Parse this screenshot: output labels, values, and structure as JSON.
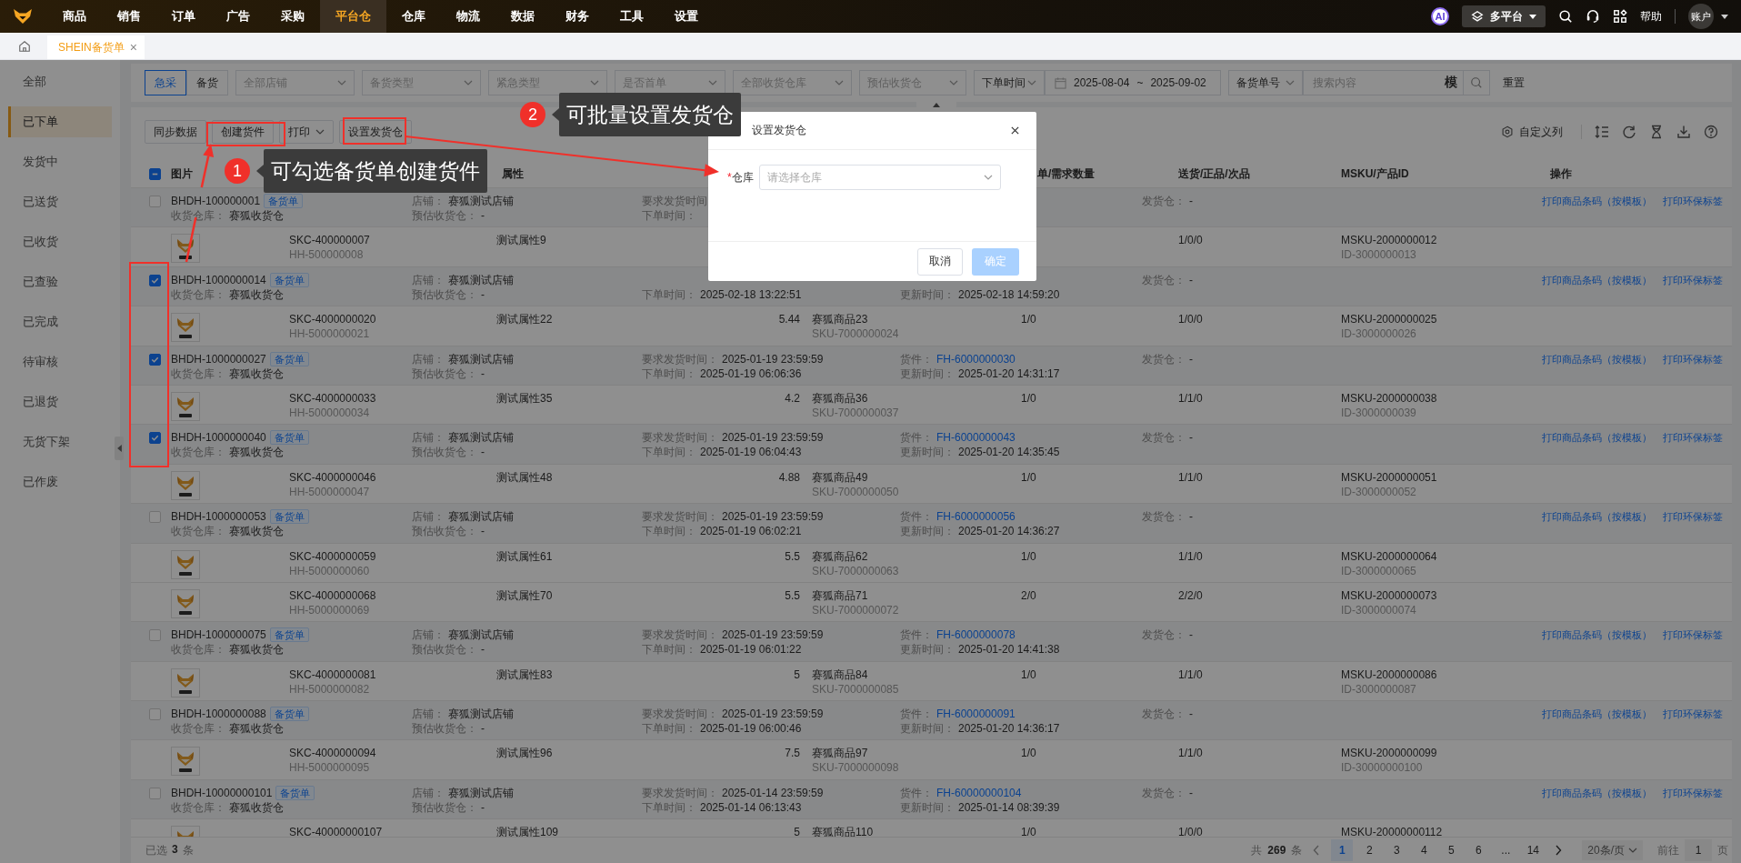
{
  "nav": {
    "items": [
      {
        "label": "商品",
        "selected": false
      },
      {
        "label": "销售",
        "selected": false
      },
      {
        "label": "订单",
        "selected": false
      },
      {
        "label": "广告",
        "selected": false
      },
      {
        "label": "采购",
        "selected": false
      },
      {
        "label": "平台仓",
        "selected": true
      },
      {
        "label": "仓库",
        "selected": false
      },
      {
        "label": "物流",
        "selected": false
      },
      {
        "label": "数据",
        "selected": false
      },
      {
        "label": "财务",
        "selected": false
      },
      {
        "label": "工具",
        "selected": false
      },
      {
        "label": "设置",
        "selected": false
      }
    ],
    "ai": "AI",
    "platform": "多平台",
    "help": "帮助",
    "account": "账户"
  },
  "tabs": [
    {
      "label": "SHEIN备货单",
      "selected": true,
      "close": "×"
    }
  ],
  "sidebar": {
    "items": [
      {
        "label": "全部",
        "selected": false
      },
      {
        "label": "已下单",
        "selected": true
      },
      {
        "label": "发货中",
        "selected": false
      },
      {
        "label": "已送货",
        "selected": false
      },
      {
        "label": "已收货",
        "selected": false
      },
      {
        "label": "已查验",
        "selected": false
      },
      {
        "label": "已完成",
        "selected": false
      },
      {
        "label": "待审核",
        "selected": false
      },
      {
        "label": "已退货",
        "selected": false
      },
      {
        "label": "无货下架",
        "selected": false
      },
      {
        "label": "已作废",
        "selected": false
      }
    ]
  },
  "filters": {
    "mode": [
      {
        "label": "急采",
        "selected": true
      },
      {
        "label": "备货",
        "selected": false
      }
    ],
    "selects": [
      {
        "placeholder": "全部店铺"
      },
      {
        "placeholder": "备货类型"
      },
      {
        "placeholder": "紧急类型"
      },
      {
        "placeholder": "是否首单"
      },
      {
        "placeholder": "全部收货仓库"
      },
      {
        "placeholder": "预估收货仓"
      }
    ],
    "time_type": "下单时间",
    "date_from": "2025-08-04",
    "date_sep": "~",
    "date_to": "2025-09-02",
    "search_type": "备货单号",
    "search_placeholder": "搜索内容",
    "fuzzy": "模",
    "reset": "重置"
  },
  "toolbar": {
    "buttons": [
      {
        "label": "同步数据",
        "kind": "plain"
      },
      {
        "label": "创建货件",
        "kind": "plain"
      },
      {
        "label": "打印",
        "kind": "dropdown"
      },
      {
        "label": "设置发货仓",
        "kind": "plain"
      }
    ],
    "custom_columns": "自定义列"
  },
  "table": {
    "select_all_indeterminate": true,
    "columns": {
      "image": "图片",
      "attribute": "属性",
      "quantity": "单/需求数量",
      "delivery": "送货/正品/次品",
      "msku": "MSKU/产品ID",
      "actions": "操作"
    },
    "rows": [
      {
        "kind": "order",
        "checked": false,
        "id": "BHDH-100000001",
        "tag": "备货单",
        "warehouse": {
          "label": "收货仓库：",
          "value": "赛狐收货仓"
        },
        "shop": {
          "label": "店铺：",
          "value": "赛狐测试店铺"
        },
        "est": {
          "label": "预估收货仓：",
          "value": "-"
        },
        "ship_time": {
          "label": "要求发货时间"
        },
        "order_time": {
          "label": "下单时间："
        },
        "ship_from": {
          "label": "发货仓：",
          "value": "-"
        },
        "actions": [
          "打印商品条码（按模板）",
          "打印环保标签"
        ]
      },
      {
        "kind": "item",
        "skc": "SKC-400000007",
        "hh": "HH-500000008",
        "attribute": "测试属性9",
        "delivery": "1/0/0",
        "msku": "MSKU-2000000012",
        "product_id": "ID-3000000013"
      },
      {
        "kind": "order",
        "checked": true,
        "id": "BHDH-1000000014",
        "tag": "备货单",
        "warehouse": {
          "label": "收货仓库：",
          "value": "赛狐收货仓"
        },
        "shop": {
          "label": "店铺：",
          "value": "赛狐测试店铺"
        },
        "est": {
          "label": "预估收货仓：",
          "value": "-"
        },
        "order_time": {
          "label": "下单时间：",
          "value": "2025-02-18 13:22:51"
        },
        "update_time": {
          "label": "更新时间：",
          "value": "2025-02-18 14:59:20"
        },
        "ship_from": {
          "label": "发货仓：",
          "value": "-"
        },
        "actions": [
          "打印商品条码（按模板）",
          "打印环保标签"
        ]
      },
      {
        "kind": "item",
        "skc": "SKC-4000000020",
        "hh": "HH-5000000021",
        "attribute": "测试属性22",
        "price": "5.44",
        "name": "赛狐商品23",
        "sku": "SKU-7000000024",
        "quantity": "1/0",
        "delivery": "1/0/0",
        "msku": "MSKU-2000000025",
        "product_id": "ID-3000000026"
      },
      {
        "kind": "order",
        "checked": true,
        "id": "BHDH-1000000027",
        "tag": "备货单",
        "warehouse": {
          "label": "收货仓库：",
          "value": "赛狐收货仓"
        },
        "shop": {
          "label": "店铺：",
          "value": "赛狐测试店铺"
        },
        "est": {
          "label": "预估收货仓：",
          "value": "-"
        },
        "ship_time": {
          "label": "要求发货时间：",
          "value": "2025-01-19 23:59:59"
        },
        "order_time": {
          "label": "下单时间：",
          "value": "2025-01-19 06:06:36"
        },
        "shipment": {
          "label": "货件：",
          "value": "FH-6000000030"
        },
        "update_time": {
          "label": "更新时间：",
          "value": "2025-01-20 14:31:17"
        },
        "ship_from": {
          "label": "发货仓：",
          "value": "-"
        },
        "actions": [
          "打印商品条码（按模板）",
          "打印环保标签"
        ]
      },
      {
        "kind": "item",
        "skc": "SKC-4000000033",
        "hh": "HH-5000000034",
        "attribute": "测试属性35",
        "price": "4.2",
        "name": "赛狐商品36",
        "sku": "SKU-7000000037",
        "quantity": "1/0",
        "delivery": "1/1/0",
        "msku": "MSKU-2000000038",
        "product_id": "ID-3000000039"
      },
      {
        "kind": "order",
        "checked": true,
        "id": "BHDH-1000000040",
        "tag": "备货单",
        "warehouse": {
          "label": "收货仓库：",
          "value": "赛狐收货仓"
        },
        "shop": {
          "label": "店铺：",
          "value": "赛狐测试店铺"
        },
        "est": {
          "label": "预估收货仓：",
          "value": "-"
        },
        "ship_time": {
          "label": "要求发货时间：",
          "value": "2025-01-19 23:59:59"
        },
        "order_time": {
          "label": "下单时间：",
          "value": "2025-01-19 06:04:43"
        },
        "shipment": {
          "label": "货件：",
          "value": "FH-6000000043"
        },
        "update_time": {
          "label": "更新时间：",
          "value": "2025-01-20 14:35:45"
        },
        "ship_from": {
          "label": "发货仓：",
          "value": "-"
        },
        "actions": [
          "打印商品条码（按模板）",
          "打印环保标签"
        ]
      },
      {
        "kind": "item",
        "skc": "SKC-4000000046",
        "hh": "HH-5000000047",
        "attribute": "测试属性48",
        "price": "4.88",
        "name": "赛狐商品49",
        "sku": "SKU-7000000050",
        "quantity": "1/0",
        "delivery": "1/1/0",
        "msku": "MSKU-2000000051",
        "product_id": "ID-3000000052"
      },
      {
        "kind": "order",
        "checked": false,
        "id": "BHDH-1000000053",
        "tag": "备货单",
        "warehouse": {
          "label": "收货仓库：",
          "value": "赛狐收货仓"
        },
        "shop": {
          "label": "店铺：",
          "value": "赛狐测试店铺"
        },
        "est": {
          "label": "预估收货仓：",
          "value": "-"
        },
        "ship_time": {
          "label": "要求发货时间：",
          "value": "2025-01-19 23:59:59"
        },
        "order_time": {
          "label": "下单时间：",
          "value": "2025-01-19 06:02:21"
        },
        "shipment": {
          "label": "货件：",
          "value": "FH-6000000056"
        },
        "update_time": {
          "label": "更新时间：",
          "value": "2025-01-20 14:36:27"
        },
        "ship_from": {
          "label": "发货仓：",
          "value": "-"
        },
        "actions": [
          "打印商品条码（按模板）",
          "打印环保标签"
        ]
      },
      {
        "kind": "item",
        "skc": "SKC-4000000059",
        "hh": "HH-5000000060",
        "attribute": "测试属性61",
        "price": "5.5",
        "name": "赛狐商品62",
        "sku": "SKU-7000000063",
        "quantity": "1/0",
        "delivery": "1/1/0",
        "msku": "MSKU-2000000064",
        "product_id": "ID-3000000065"
      },
      {
        "kind": "item",
        "skc": "SKC-4000000068",
        "hh": "HH-5000000069",
        "attribute": "测试属性70",
        "price": "5.5",
        "name": "赛狐商品71",
        "sku": "SKU-7000000072",
        "quantity": "2/0",
        "delivery": "2/2/0",
        "msku": "MSKU-2000000073",
        "product_id": "ID-3000000074"
      },
      {
        "kind": "order",
        "checked": false,
        "id": "BHDH-1000000075",
        "tag": "备货单",
        "warehouse": {
          "label": "收货仓库：",
          "value": "赛狐收货仓"
        },
        "shop": {
          "label": "店铺：",
          "value": "赛狐测试店铺"
        },
        "est": {
          "label": "预估收货仓：",
          "value": "-"
        },
        "ship_time": {
          "label": "要求发货时间：",
          "value": "2025-01-19 23:59:59"
        },
        "order_time": {
          "label": "下单时间：",
          "value": "2025-01-19 06:01:22"
        },
        "shipment": {
          "label": "货件：",
          "value": "FH-6000000078"
        },
        "update_time": {
          "label": "更新时间：",
          "value": "2025-01-20 14:41:38"
        },
        "ship_from": {
          "label": "发货仓：",
          "value": "-"
        },
        "actions": [
          "打印商品条码（按模板）",
          "打印环保标签"
        ]
      },
      {
        "kind": "item",
        "skc": "SKC-4000000081",
        "hh": "HH-5000000082",
        "attribute": "测试属性83",
        "price": "5",
        "name": "赛狐商品84",
        "sku": "SKU-7000000085",
        "quantity": "1/0",
        "delivery": "1/1/0",
        "msku": "MSKU-2000000086",
        "product_id": "ID-3000000087"
      },
      {
        "kind": "order",
        "checked": false,
        "id": "BHDH-1000000088",
        "tag": "备货单",
        "warehouse": {
          "label": "收货仓库：",
          "value": "赛狐收货仓"
        },
        "shop": {
          "label": "店铺：",
          "value": "赛狐测试店铺"
        },
        "est": {
          "label": "预估收货仓：",
          "value": "-"
        },
        "ship_time": {
          "label": "要求发货时间：",
          "value": "2025-01-19 23:59:59"
        },
        "order_time": {
          "label": "下单时间：",
          "value": "2025-01-19 06:00:46"
        },
        "shipment": {
          "label": "货件：",
          "value": "FH-6000000091"
        },
        "update_time": {
          "label": "更新时间：",
          "value": "2025-01-20 14:36:17"
        },
        "ship_from": {
          "label": "发货仓：",
          "value": "-"
        },
        "actions": [
          "打印商品条码（按模板）",
          "打印环保标签"
        ]
      },
      {
        "kind": "item",
        "skc": "SKC-4000000094",
        "hh": "HH-5000000095",
        "attribute": "测试属性96",
        "price": "7.5",
        "name": "赛狐商品97",
        "sku": "SKU-7000000098",
        "quantity": "1/0",
        "delivery": "1/1/0",
        "msku": "MSKU-2000000099",
        "product_id": "ID-30000000100"
      },
      {
        "kind": "order",
        "checked": false,
        "id": "BHDH-10000000101",
        "tag": "备货单",
        "warehouse": {
          "label": "收货仓库：",
          "value": "赛狐收货仓"
        },
        "shop": {
          "label": "店铺：",
          "value": "赛狐测试店铺"
        },
        "est": {
          "label": "预估收货仓：",
          "value": "-"
        },
        "ship_time": {
          "label": "要求发货时间：",
          "value": "2025-01-14 23:59:59"
        },
        "order_time": {
          "label": "下单时间：",
          "value": "2025-01-14 06:13:43"
        },
        "shipment": {
          "label": "货件：",
          "value": "FH-60000000104"
        },
        "update_time": {
          "label": "更新时间：",
          "value": "2025-01-14 08:39:39"
        },
        "ship_from": {
          "label": "发货仓：",
          "value": "-"
        },
        "actions": [
          "打印商品条码（按模板）",
          "打印环保标签"
        ]
      },
      {
        "kind": "item",
        "skc": "SKC-40000000107",
        "attribute": "测试属性109",
        "price": "5",
        "name": "赛狐商品110",
        "quantity": "1/0",
        "delivery": "1/0/0",
        "msku": "MSKU-20000000112"
      }
    ]
  },
  "footer": {
    "selected_prefix": "已选",
    "selected_count": "3",
    "selected_suffix": "条",
    "total_prefix": "共",
    "total": "269",
    "total_suffix": "条",
    "pages": [
      {
        "label": "1",
        "selected": true
      },
      {
        "label": "2",
        "selected": false
      },
      {
        "label": "3",
        "selected": false
      },
      {
        "label": "4",
        "selected": false
      },
      {
        "label": "5",
        "selected": false
      },
      {
        "label": "6",
        "selected": false
      },
      {
        "label": "...",
        "selected": false
      },
      {
        "label": "14",
        "selected": false
      }
    ],
    "page_size": "20条/页",
    "goto": "前往",
    "goto_value": "1",
    "goto_suffix": "页"
  },
  "dialog": {
    "title": "设置发货仓",
    "required_mark": "*",
    "field_label": "仓库",
    "placeholder": "请选择仓库",
    "cancel": "取消",
    "confirm": "确定",
    "confirm_disabled": true
  },
  "callouts": [
    {
      "number": "1",
      "text": "可勾选备货单创建货件"
    },
    {
      "number": "2",
      "text": "可批量设置发货仓"
    }
  ]
}
